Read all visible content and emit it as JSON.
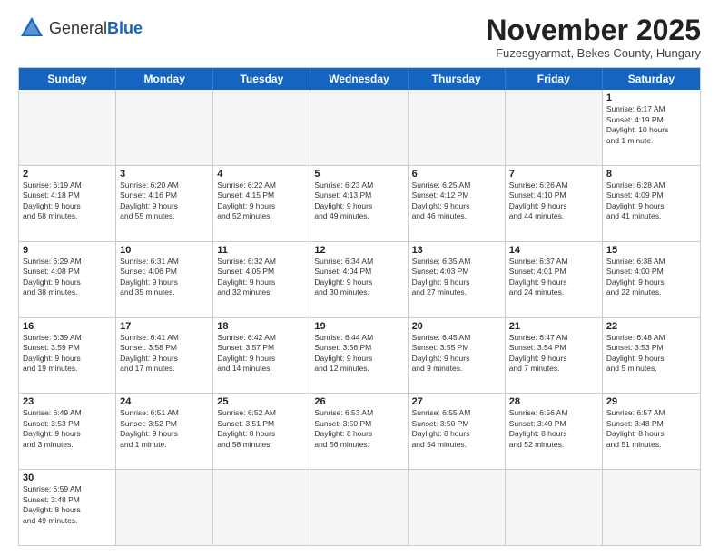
{
  "header": {
    "logo_general": "General",
    "logo_blue": "Blue",
    "month_title": "November 2025",
    "subtitle": "Fuzesgyarmat, Bekes County, Hungary"
  },
  "weekdays": [
    "Sunday",
    "Monday",
    "Tuesday",
    "Wednesday",
    "Thursday",
    "Friday",
    "Saturday"
  ],
  "rows": [
    [
      {
        "day": "",
        "info": ""
      },
      {
        "day": "",
        "info": ""
      },
      {
        "day": "",
        "info": ""
      },
      {
        "day": "",
        "info": ""
      },
      {
        "day": "",
        "info": ""
      },
      {
        "day": "",
        "info": ""
      },
      {
        "day": "1",
        "info": "Sunrise: 6:17 AM\nSunset: 4:19 PM\nDaylight: 10 hours\nand 1 minute."
      }
    ],
    [
      {
        "day": "2",
        "info": "Sunrise: 6:19 AM\nSunset: 4:18 PM\nDaylight: 9 hours\nand 58 minutes."
      },
      {
        "day": "3",
        "info": "Sunrise: 6:20 AM\nSunset: 4:16 PM\nDaylight: 9 hours\nand 55 minutes."
      },
      {
        "day": "4",
        "info": "Sunrise: 6:22 AM\nSunset: 4:15 PM\nDaylight: 9 hours\nand 52 minutes."
      },
      {
        "day": "5",
        "info": "Sunrise: 6:23 AM\nSunset: 4:13 PM\nDaylight: 9 hours\nand 49 minutes."
      },
      {
        "day": "6",
        "info": "Sunrise: 6:25 AM\nSunset: 4:12 PM\nDaylight: 9 hours\nand 46 minutes."
      },
      {
        "day": "7",
        "info": "Sunrise: 6:26 AM\nSunset: 4:10 PM\nDaylight: 9 hours\nand 44 minutes."
      },
      {
        "day": "8",
        "info": "Sunrise: 6:28 AM\nSunset: 4:09 PM\nDaylight: 9 hours\nand 41 minutes."
      }
    ],
    [
      {
        "day": "9",
        "info": "Sunrise: 6:29 AM\nSunset: 4:08 PM\nDaylight: 9 hours\nand 38 minutes."
      },
      {
        "day": "10",
        "info": "Sunrise: 6:31 AM\nSunset: 4:06 PM\nDaylight: 9 hours\nand 35 minutes."
      },
      {
        "day": "11",
        "info": "Sunrise: 6:32 AM\nSunset: 4:05 PM\nDaylight: 9 hours\nand 32 minutes."
      },
      {
        "day": "12",
        "info": "Sunrise: 6:34 AM\nSunset: 4:04 PM\nDaylight: 9 hours\nand 30 minutes."
      },
      {
        "day": "13",
        "info": "Sunrise: 6:35 AM\nSunset: 4:03 PM\nDaylight: 9 hours\nand 27 minutes."
      },
      {
        "day": "14",
        "info": "Sunrise: 6:37 AM\nSunset: 4:01 PM\nDaylight: 9 hours\nand 24 minutes."
      },
      {
        "day": "15",
        "info": "Sunrise: 6:38 AM\nSunset: 4:00 PM\nDaylight: 9 hours\nand 22 minutes."
      }
    ],
    [
      {
        "day": "16",
        "info": "Sunrise: 6:39 AM\nSunset: 3:59 PM\nDaylight: 9 hours\nand 19 minutes."
      },
      {
        "day": "17",
        "info": "Sunrise: 6:41 AM\nSunset: 3:58 PM\nDaylight: 9 hours\nand 17 minutes."
      },
      {
        "day": "18",
        "info": "Sunrise: 6:42 AM\nSunset: 3:57 PM\nDaylight: 9 hours\nand 14 minutes."
      },
      {
        "day": "19",
        "info": "Sunrise: 6:44 AM\nSunset: 3:56 PM\nDaylight: 9 hours\nand 12 minutes."
      },
      {
        "day": "20",
        "info": "Sunrise: 6:45 AM\nSunset: 3:55 PM\nDaylight: 9 hours\nand 9 minutes."
      },
      {
        "day": "21",
        "info": "Sunrise: 6:47 AM\nSunset: 3:54 PM\nDaylight: 9 hours\nand 7 minutes."
      },
      {
        "day": "22",
        "info": "Sunrise: 6:48 AM\nSunset: 3:53 PM\nDaylight: 9 hours\nand 5 minutes."
      }
    ],
    [
      {
        "day": "23",
        "info": "Sunrise: 6:49 AM\nSunset: 3:53 PM\nDaylight: 9 hours\nand 3 minutes."
      },
      {
        "day": "24",
        "info": "Sunrise: 6:51 AM\nSunset: 3:52 PM\nDaylight: 9 hours\nand 1 minute."
      },
      {
        "day": "25",
        "info": "Sunrise: 6:52 AM\nSunset: 3:51 PM\nDaylight: 8 hours\nand 58 minutes."
      },
      {
        "day": "26",
        "info": "Sunrise: 6:53 AM\nSunset: 3:50 PM\nDaylight: 8 hours\nand 56 minutes."
      },
      {
        "day": "27",
        "info": "Sunrise: 6:55 AM\nSunset: 3:50 PM\nDaylight: 8 hours\nand 54 minutes."
      },
      {
        "day": "28",
        "info": "Sunrise: 6:56 AM\nSunset: 3:49 PM\nDaylight: 8 hours\nand 52 minutes."
      },
      {
        "day": "29",
        "info": "Sunrise: 6:57 AM\nSunset: 3:48 PM\nDaylight: 8 hours\nand 51 minutes."
      }
    ],
    [
      {
        "day": "30",
        "info": "Sunrise: 6:59 AM\nSunset: 3:48 PM\nDaylight: 8 hours\nand 49 minutes."
      },
      {
        "day": "",
        "info": ""
      },
      {
        "day": "",
        "info": ""
      },
      {
        "day": "",
        "info": ""
      },
      {
        "day": "",
        "info": ""
      },
      {
        "day": "",
        "info": ""
      },
      {
        "day": "",
        "info": ""
      }
    ]
  ]
}
